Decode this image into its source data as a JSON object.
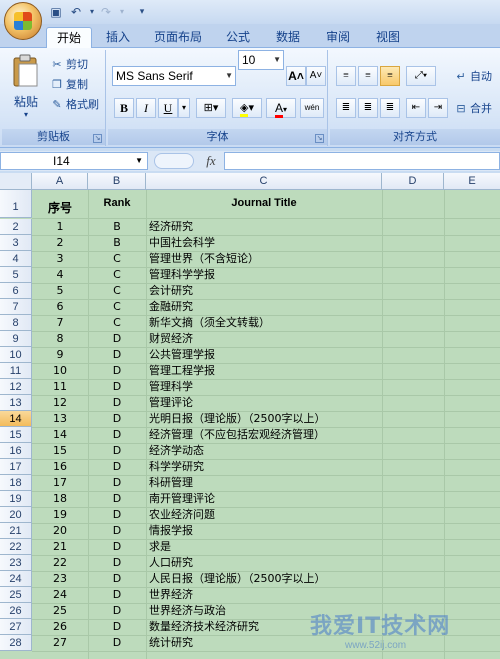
{
  "ribbon": {
    "tabs": [
      "开始",
      "插入",
      "页面布局",
      "公式",
      "数据",
      "审阅",
      "视图"
    ],
    "active_tab": "开始",
    "clipboard": {
      "paste": "粘贴",
      "cut": "剪切",
      "copy": "复制",
      "format_painter": "格式刷",
      "label": "剪贴板"
    },
    "font": {
      "name": "MS Sans Serif",
      "size": "10",
      "bold": "B",
      "italic": "I",
      "underline": "U",
      "label": "字体",
      "grow": "A",
      "shrink": "A",
      "font_color_glyph": "A",
      "phonetic": "wén"
    },
    "alignment": {
      "label": "对齐方式",
      "wrap": "自动",
      "merge": "合并"
    }
  },
  "formula_bar": {
    "name_box": "I14",
    "fx": "fx",
    "value": ""
  },
  "sheet": {
    "columns": [
      "A",
      "B",
      "C",
      "D",
      "E"
    ],
    "header_row": {
      "a": "序号",
      "b": "Rank",
      "c": "Journal Title"
    },
    "selected_row": "14",
    "rows": [
      {
        "n": "2",
        "a": "1",
        "b": "B",
        "c": "经济研究"
      },
      {
        "n": "3",
        "a": "2",
        "b": "B",
        "c": "中国社会科学"
      },
      {
        "n": "4",
        "a": "3",
        "b": "C",
        "c": "管理世界（不含短论）"
      },
      {
        "n": "5",
        "a": "4",
        "b": "C",
        "c": "管理科学学报"
      },
      {
        "n": "6",
        "a": "5",
        "b": "C",
        "c": "会计研究"
      },
      {
        "n": "7",
        "a": "6",
        "b": "C",
        "c": "金融研究"
      },
      {
        "n": "8",
        "a": "7",
        "b": "C",
        "c": "新华文摘（须全文转载）"
      },
      {
        "n": "9",
        "a": "8",
        "b": "D",
        "c": "财贸经济"
      },
      {
        "n": "10",
        "a": "9",
        "b": "D",
        "c": "公共管理学报"
      },
      {
        "n": "11",
        "a": "10",
        "b": "D",
        "c": "管理工程学报"
      },
      {
        "n": "12",
        "a": "11",
        "b": "D",
        "c": "管理科学"
      },
      {
        "n": "13",
        "a": "12",
        "b": "D",
        "c": "管理评论"
      },
      {
        "n": "14",
        "a": "13",
        "b": "D",
        "c": "光明日报（理论版）（2500字以上）"
      },
      {
        "n": "15",
        "a": "14",
        "b": "D",
        "c": "经济管理（不应包括宏观经济管理）"
      },
      {
        "n": "16",
        "a": "15",
        "b": "D",
        "c": "经济学动态"
      },
      {
        "n": "17",
        "a": "16",
        "b": "D",
        "c": "科学学研究"
      },
      {
        "n": "18",
        "a": "17",
        "b": "D",
        "c": "科研管理"
      },
      {
        "n": "19",
        "a": "18",
        "b": "D",
        "c": "南开管理评论"
      },
      {
        "n": "20",
        "a": "19",
        "b": "D",
        "c": "农业经济问题"
      },
      {
        "n": "21",
        "a": "20",
        "b": "D",
        "c": "情报学报"
      },
      {
        "n": "22",
        "a": "21",
        "b": "D",
        "c": "求是"
      },
      {
        "n": "23",
        "a": "22",
        "b": "D",
        "c": "人口研究"
      },
      {
        "n": "24",
        "a": "23",
        "b": "D",
        "c": "人民日报（理论版）（2500字以上）"
      },
      {
        "n": "25",
        "a": "24",
        "b": "D",
        "c": "世界经济"
      },
      {
        "n": "26",
        "a": "25",
        "b": "D",
        "c": "世界经济与政治"
      },
      {
        "n": "27",
        "a": "26",
        "b": "D",
        "c": "数量经济技术经济研究"
      },
      {
        "n": "28",
        "a": "27",
        "b": "D",
        "c": "统计研究"
      }
    ]
  },
  "watermark": {
    "title": "我爱IT技术网",
    "url": "www.52ij.com"
  },
  "colors": {
    "grid_bg": "#bddbbc",
    "selected_row": "#f3bb5b",
    "ribbon_text": "#15428b"
  }
}
